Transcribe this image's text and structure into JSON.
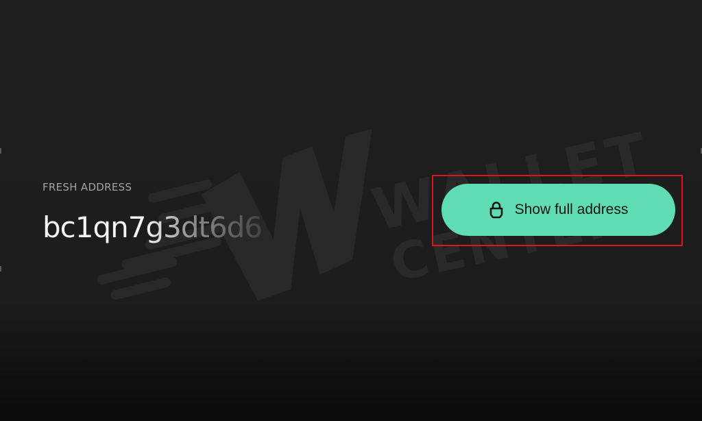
{
  "address": {
    "label": "FRESH ADDRESS",
    "value": "bc1qn7g3dt6d6"
  },
  "reveal_button": {
    "label": "Show full address",
    "icon": "lock-icon",
    "color": "#5fdcb3"
  },
  "highlight_color": "#e0141c",
  "watermark_text": "WALLET CENTER"
}
